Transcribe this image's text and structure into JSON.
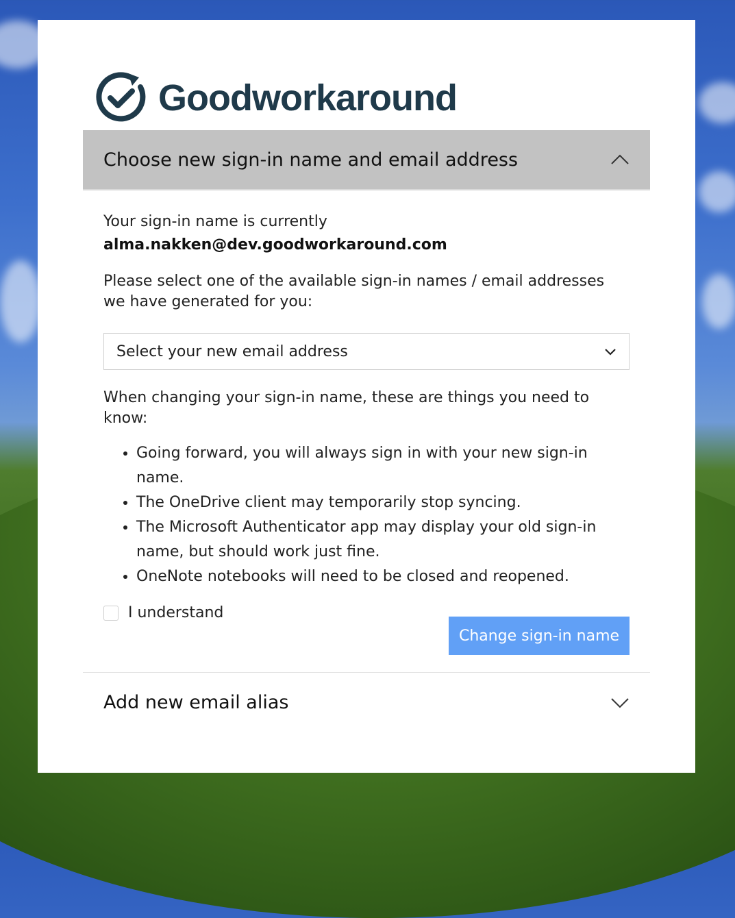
{
  "brand": {
    "name": "Goodworkaround",
    "color": "#1f3a4a"
  },
  "sections": {
    "change_signin": {
      "title": "Choose new sign-in name and email address",
      "expanded": true,
      "current_label": "Your sign-in name is currently",
      "current_value": "alma.nakken@dev.goodworkaround.com",
      "instruction": "Please select one of the available sign-in names / email addresses we have generated for you:",
      "select_placeholder": "Select your new email address",
      "know_intro": "When changing your sign-in name, these are things you need to know:",
      "bullets": [
        "Going forward, you will always sign in with your new sign-in name.",
        "The OneDrive client may temporarily stop syncing.",
        "The Microsoft Authenticator app may display your old sign-in name, but should work just fine.",
        "OneNote notebooks will need to be closed and reopened."
      ],
      "checkbox_label": "I understand",
      "checkbox_checked": false,
      "button_label": "Change sign-in name",
      "button_color": "#61a0f6"
    },
    "add_alias": {
      "title": "Add new email alias",
      "expanded": false
    }
  },
  "icons": {
    "logo": "check-circle-arrow-icon",
    "collapse": "chevron-up-icon",
    "expand": "chevron-down-icon"
  }
}
